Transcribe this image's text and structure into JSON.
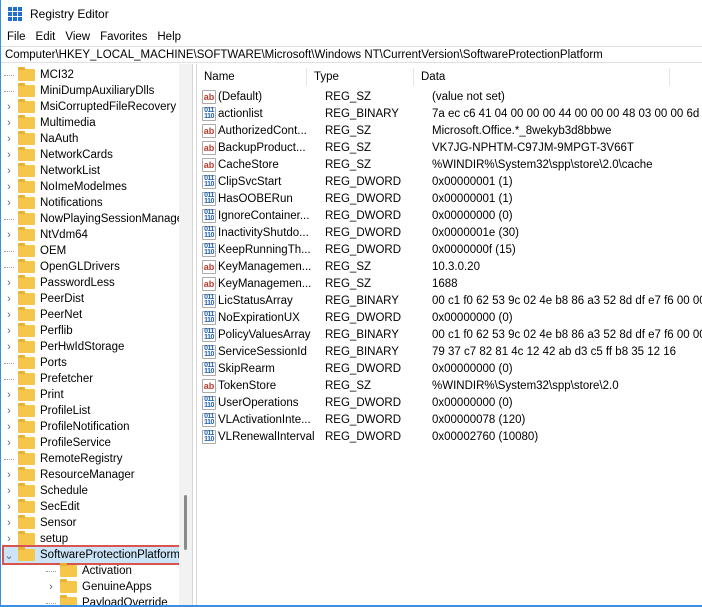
{
  "window": {
    "title": "Registry Editor",
    "icon": "registry-editor-icon"
  },
  "menu": [
    "File",
    "Edit",
    "View",
    "Favorites",
    "Help"
  ],
  "address": "Computer\\HKEY_LOCAL_MACHINE\\SOFTWARE\\Microsoft\\Windows NT\\CurrentVersion\\SoftwareProtectionPlatform",
  "tree": [
    {
      "label": "MCI32",
      "expandable": false
    },
    {
      "label": "MiniDumpAuxiliaryDlls",
      "expandable": false
    },
    {
      "label": "MsiCorruptedFileRecovery",
      "expandable": true
    },
    {
      "label": "Multimedia",
      "expandable": true
    },
    {
      "label": "NaAuth",
      "expandable": true
    },
    {
      "label": "NetworkCards",
      "expandable": true
    },
    {
      "label": "NetworkList",
      "expandable": true
    },
    {
      "label": "NoImeModelmes",
      "expandable": true
    },
    {
      "label": "Notifications",
      "expandable": true
    },
    {
      "label": "NowPlayingSessionManager",
      "expandable": false
    },
    {
      "label": "NtVdm64",
      "expandable": true
    },
    {
      "label": "OEM",
      "expandable": false
    },
    {
      "label": "OpenGLDrivers",
      "expandable": false
    },
    {
      "label": "PasswordLess",
      "expandable": true
    },
    {
      "label": "PeerDist",
      "expandable": true
    },
    {
      "label": "PeerNet",
      "expandable": true
    },
    {
      "label": "Perflib",
      "expandable": true
    },
    {
      "label": "PerHwIdStorage",
      "expandable": true
    },
    {
      "label": "Ports",
      "expandable": false
    },
    {
      "label": "Prefetcher",
      "expandable": false
    },
    {
      "label": "Print",
      "expandable": true
    },
    {
      "label": "ProfileList",
      "expandable": true
    },
    {
      "label": "ProfileNotification",
      "expandable": true
    },
    {
      "label": "ProfileService",
      "expandable": true
    },
    {
      "label": "RemoteRegistry",
      "expandable": false
    },
    {
      "label": "ResourceManager",
      "expandable": true
    },
    {
      "label": "Schedule",
      "expandable": true
    },
    {
      "label": "SecEdit",
      "expandable": true
    },
    {
      "label": "Sensor",
      "expandable": true
    },
    {
      "label": "setup",
      "expandable": true
    },
    {
      "label": "SoftwareProtectionPlatform",
      "expandable": true,
      "expanded": true,
      "selected": true
    },
    {
      "label": "Activation",
      "expandable": false,
      "child": true
    },
    {
      "label": "GenuineApps",
      "expandable": true,
      "child": true
    },
    {
      "label": "PayloadOverride",
      "expandable": false,
      "child": true
    }
  ],
  "columns": {
    "name": "Name",
    "type": "Type",
    "data": "Data"
  },
  "values": [
    {
      "name": "(Default)",
      "type": "REG_SZ",
      "data": "(value not set)"
    },
    {
      "name": "actionlist",
      "type": "REG_BINARY",
      "data": "7a ec c6 41 04 00 00 00 44 00 00 00 48 03 00 00 6d 0..."
    },
    {
      "name": "AuthorizedCont...",
      "type": "REG_SZ",
      "data": "Microsoft.Office.*_8wekyb3d8bbwe"
    },
    {
      "name": "BackupProduct...",
      "type": "REG_SZ",
      "data": "VK7JG-NPHTM-C97JM-9MPGT-3V66T"
    },
    {
      "name": "CacheStore",
      "type": "REG_SZ",
      "data": "%WINDIR%\\System32\\spp\\store\\2.0\\cache"
    },
    {
      "name": "ClipSvcStart",
      "type": "REG_DWORD",
      "data": "0x00000001 (1)"
    },
    {
      "name": "HasOOBERun",
      "type": "REG_DWORD",
      "data": "0x00000001 (1)"
    },
    {
      "name": "IgnoreContainer...",
      "type": "REG_DWORD",
      "data": "0x00000000 (0)"
    },
    {
      "name": "InactivityShutdo...",
      "type": "REG_DWORD",
      "data": "0x0000001e (30)"
    },
    {
      "name": "KeepRunningTh...",
      "type": "REG_DWORD",
      "data": "0x0000000f (15)"
    },
    {
      "name": "KeyManagemen...",
      "type": "REG_SZ",
      "data": "10.3.0.20"
    },
    {
      "name": "KeyManagemen...",
      "type": "REG_SZ",
      "data": "1688"
    },
    {
      "name": "LicStatusArray",
      "type": "REG_BINARY",
      "data": "00 c1 f0 62 53 9c 02 4e b8 86 a3 52 8d df e7 f6 00 00 ..."
    },
    {
      "name": "NoExpirationUX",
      "type": "REG_DWORD",
      "data": "0x00000000 (0)"
    },
    {
      "name": "PolicyValuesArray",
      "type": "REG_BINARY",
      "data": "00 c1 f0 62 53 9c 02 4e b8 86 a3 52 8d df e7 f6 00 00 ..."
    },
    {
      "name": "ServiceSessionId",
      "type": "REG_BINARY",
      "data": "79 37 c7 82 81 4c 12 42 ab d3 c5 ff b8 35 12 16"
    },
    {
      "name": "SkipRearm",
      "type": "REG_DWORD",
      "data": "0x00000000 (0)"
    },
    {
      "name": "TokenStore",
      "type": "REG_SZ",
      "data": "%WINDIR%\\System32\\spp\\store\\2.0"
    },
    {
      "name": "UserOperations",
      "type": "REG_DWORD",
      "data": "0x00000000 (0)"
    },
    {
      "name": "VLActivationInte...",
      "type": "REG_DWORD",
      "data": "0x00000078 (120)"
    },
    {
      "name": "VLRenewalInterval",
      "type": "REG_DWORD",
      "data": "0x00002760 (10080)"
    }
  ],
  "colors": {
    "selection": "#cce4f7",
    "highlight_border": "#d9534f",
    "folder": "#f5c64a"
  }
}
